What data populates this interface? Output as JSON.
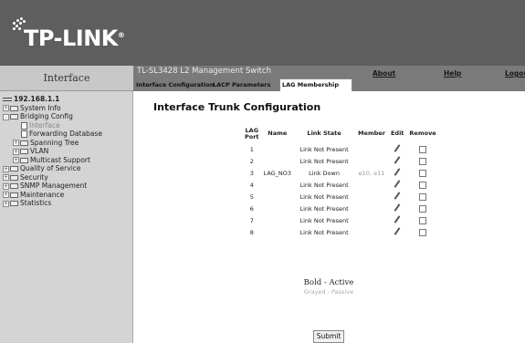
{
  "header": {
    "brand": "TP-LINK",
    "brand_mark": "®"
  },
  "sidebar": {
    "section_title": "Interface",
    "tree": [
      {
        "label": "192.168.1.1",
        "level": 0,
        "icon": "root-icon",
        "expander": ""
      },
      {
        "label": "System Info",
        "level": 0,
        "icon": "folder-icon",
        "expander": "+"
      },
      {
        "label": "Bridging Config",
        "level": 0,
        "icon": "folder-icon",
        "expander": "-"
      },
      {
        "label": "Interface",
        "level": 1,
        "icon": "document-icon",
        "expander": "",
        "selected": true
      },
      {
        "label": "Forwarding Database",
        "level": 1,
        "icon": "document-icon",
        "expander": ""
      },
      {
        "label": "Spanning Tree",
        "level": 1,
        "icon": "folder-icon",
        "expander": "+"
      },
      {
        "label": "VLAN",
        "level": 1,
        "icon": "folder-icon",
        "expander": "+"
      },
      {
        "label": "Multicast Support",
        "level": 1,
        "icon": "folder-icon",
        "expander": "+"
      },
      {
        "label": "Quality of Service",
        "level": 0,
        "icon": "folder-icon",
        "expander": "+"
      },
      {
        "label": "Security",
        "level": 0,
        "icon": "folder-icon",
        "expander": "+"
      },
      {
        "label": "SNMP Management",
        "level": 0,
        "icon": "folder-icon",
        "expander": "+"
      },
      {
        "label": "Maintenance",
        "level": 0,
        "icon": "folder-icon",
        "expander": "+"
      },
      {
        "label": "Statistics",
        "level": 0,
        "icon": "folder-icon",
        "expander": "+"
      }
    ]
  },
  "topbar": {
    "device_name": "TL-SL3428 L2 Management Switch",
    "links": [
      "About",
      "Help",
      "Logou"
    ]
  },
  "tabs": [
    "Interface Configuration",
    "LACP Parameters",
    "LAG Membership"
  ],
  "main": {
    "title": "Interface Trunk Configuration",
    "columns": [
      "LAG Port",
      "Name",
      "Link State",
      "Member",
      "Edit",
      "Remove"
    ],
    "rows": [
      {
        "port": "1",
        "name": "",
        "state": "Link Not Present",
        "member": ""
      },
      {
        "port": "2",
        "name": "",
        "state": "Link Not Present",
        "member": ""
      },
      {
        "port": "3",
        "name": "LAG_NO3",
        "state": "Link Down",
        "member": "e10, e11"
      },
      {
        "port": "4",
        "name": "",
        "state": "Link Not Present",
        "member": ""
      },
      {
        "port": "5",
        "name": "",
        "state": "Link Not Present",
        "member": ""
      },
      {
        "port": "6",
        "name": "",
        "state": "Link Not Present",
        "member": ""
      },
      {
        "port": "7",
        "name": "",
        "state": "Link Not Present",
        "member": ""
      },
      {
        "port": "8",
        "name": "",
        "state": "Link Not Present",
        "member": ""
      }
    ],
    "legend_active": "Bold - Active",
    "legend_passive": "Grayed - Passive",
    "submit_label": "Submit"
  }
}
